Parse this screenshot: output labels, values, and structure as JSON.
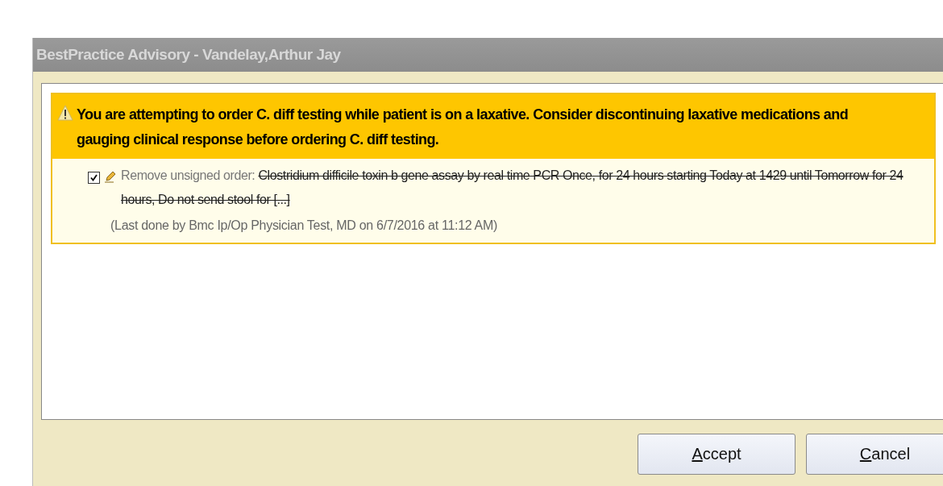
{
  "window": {
    "title": "BestPractice Advisory  - Vandelay,Arthur Jay"
  },
  "advisory": {
    "message": "You are attempting to order C. diff testing while patient is on a laxative. Consider discontinuing laxative medications and gauging clinical response before ordering C. diff testing.",
    "actions": [
      {
        "checked": true,
        "label": "Remove unsigned order:",
        "order": "Clostridium difficile toxin b gene assay by real time PCR Once, for 24 hours starting Today at 1429 until Tomorrow for 24 hours, Do not send stool for [...]",
        "note": "(Last done by Bmc Ip/Op Physician Test, MD on 6/7/2016 at 11:12 AM)"
      }
    ]
  },
  "buttons": [
    {
      "label": "Accept"
    },
    {
      "label": "Cancel"
    }
  ]
}
